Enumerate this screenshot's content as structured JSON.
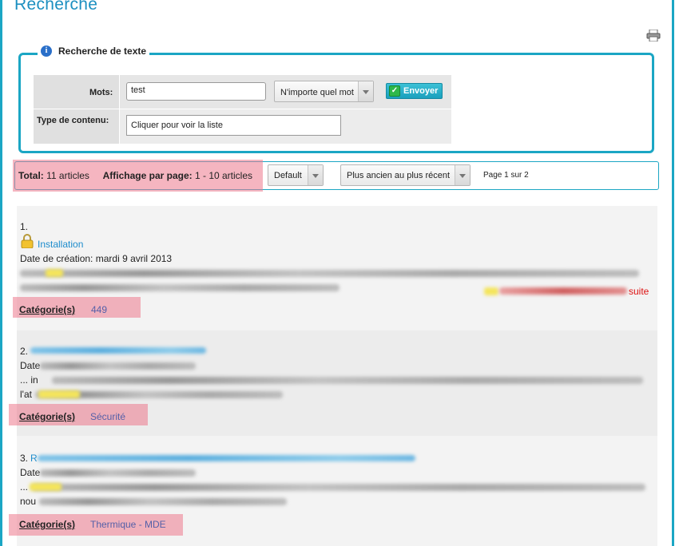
{
  "page": {
    "title": "Recherche"
  },
  "search": {
    "legend": "Recherche de texte",
    "mots_label": "Mots:",
    "mots_value": "test",
    "match_mode": "N'importe quel mot",
    "send_label": "Envoyer",
    "type_label": "Type de contenu:",
    "type_value": "Cliquer pour voir la liste"
  },
  "toolbar": {
    "total_label": "Total:",
    "total_value": "11 articles",
    "per_page_label": "Affichage par page:",
    "per_page_value": "1 - 10 articles",
    "sort_default": "Default",
    "sort_order": "Plus ancien au plus récent",
    "page_info": "Page 1 sur 2"
  },
  "results": [
    {
      "number": "1.",
      "title": "Installation",
      "date": "Date de création: mardi 9 avril 2013",
      "more": "suite",
      "category_label": "Catégorie(s)",
      "category_value": "449"
    },
    {
      "number": "2.",
      "category_label": "Catégorie(s)",
      "category_value": "Sécurité",
      "date_prefix": "Date",
      "excerpt_prefix": "... in",
      "line3_prefix": "l'at"
    },
    {
      "number": "3.",
      "title_prefix": "R",
      "category_label": "Catégorie(s)",
      "category_value": "Thermique - MDE",
      "date_prefix": "Date",
      "excerpt_prefix": "...",
      "line3_prefix": "nou"
    }
  ],
  "icons": [
    "print-icon",
    "info-icon",
    "lock-icon",
    "check-icon"
  ]
}
